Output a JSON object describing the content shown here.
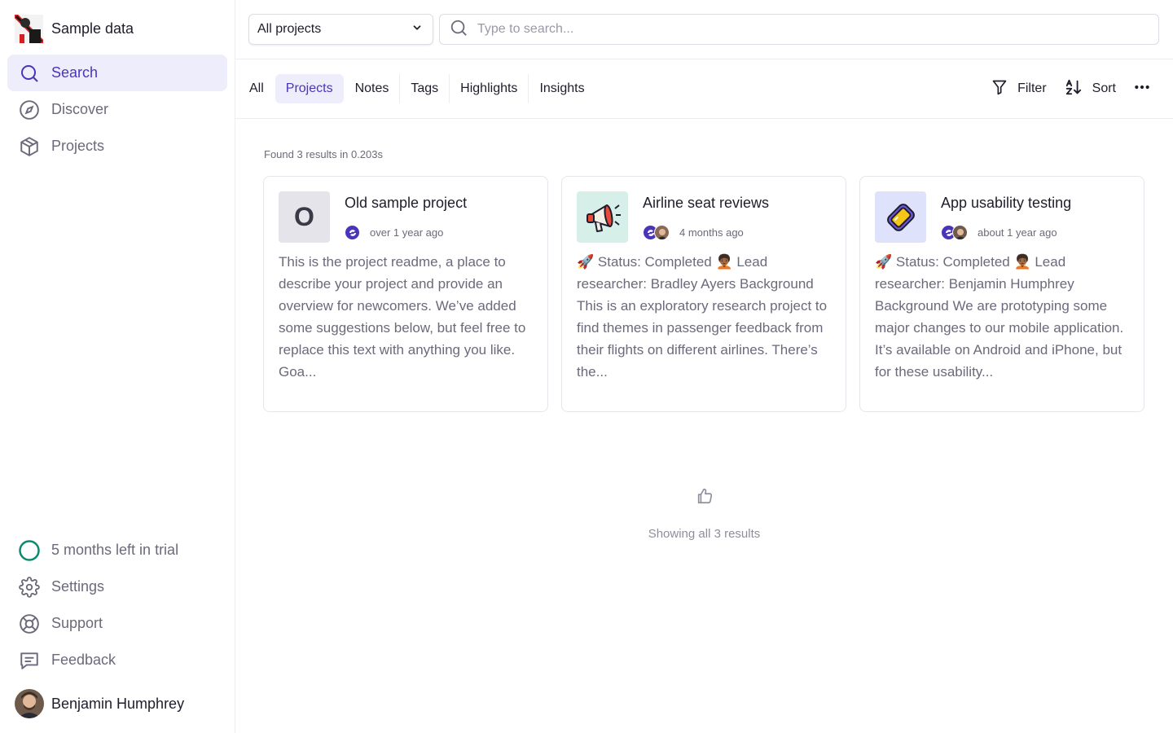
{
  "sidebar": {
    "workspace_name": "Sample data",
    "nav": [
      {
        "label": "Search",
        "icon": "search-icon",
        "active": true
      },
      {
        "label": "Discover",
        "icon": "compass-icon",
        "active": false
      },
      {
        "label": "Projects",
        "icon": "box-icon",
        "active": false
      }
    ],
    "bottom": [
      {
        "label": "5 months left in trial",
        "icon": "trial-circle-icon"
      },
      {
        "label": "Settings",
        "icon": "gear-icon"
      },
      {
        "label": "Support",
        "icon": "lifebuoy-icon"
      },
      {
        "label": "Feedback",
        "icon": "message-icon"
      }
    ],
    "user_name": "Benjamin Humphrey"
  },
  "topbar": {
    "project_filter": "All projects",
    "search_placeholder": "Type to search..."
  },
  "tabs": [
    "All",
    "Projects",
    "Notes",
    "Tags",
    "Highlights",
    "Insights"
  ],
  "active_tab": "Projects",
  "actions": {
    "filter": "Filter",
    "sort": "Sort"
  },
  "results_info": "Found 3 results in 0.203s",
  "cards": [
    {
      "title": "Old sample project",
      "thumb_letter": "O",
      "time": "over 1 year ago",
      "description": "This is the project readme, a place to describe your project and provide an overview for newcomers. We’ve added some suggestions below, but feel free to replace this text with anything you like. Goa..."
    },
    {
      "title": "Airline seat reviews",
      "thumb_icon": "megaphone-icon",
      "time": "4 months ago",
      "description": "🚀 Status: Completed 🧑🏾‍🦱 Lead researcher: Bradley Ayers Background This is an exploratory research project to find themes in passenger feedback from their flights on different airlines. There’s the..."
    },
    {
      "title": "App usability testing",
      "thumb_icon": "phone-icon",
      "time": "about 1 year ago",
      "description": "🚀 Status: Completed 🧑🏾‍🦱 Lead researcher: Benjamin Humphrey Background We are prototyping some major changes to our mobile application. It’s available on Android and iPhone, but for these usability..."
    }
  ],
  "footer_text": "Showing all 3 results",
  "colors": {
    "accent": "#4c34b8",
    "accent_bg": "#eeedfb",
    "trial": "#0f8a6f"
  }
}
